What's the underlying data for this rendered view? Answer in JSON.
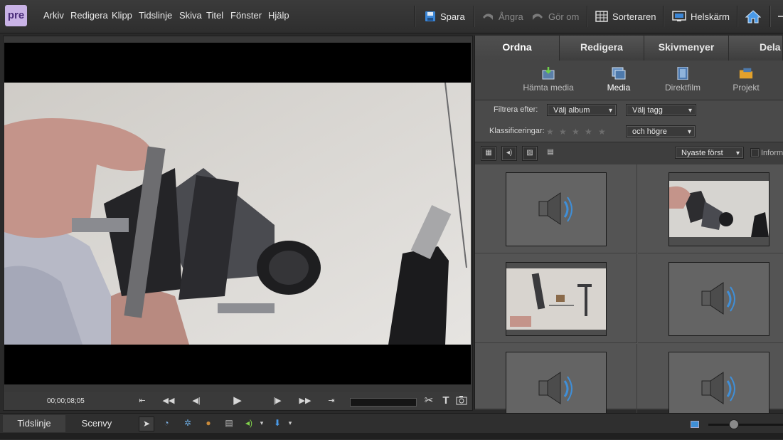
{
  "app": {
    "logo_text": "pre"
  },
  "menu": [
    "Arkiv",
    "Redigera",
    "Klipp",
    "Tidslinje",
    "Skiva",
    "Titel",
    "Fönster",
    "Hjälp"
  ],
  "toolbar": {
    "save": "Spara",
    "undo": "Ångra",
    "redo": "Gör om",
    "organizer": "Sorteraren",
    "fullscreen": "Helskärm"
  },
  "monitor": {
    "timecode": "00;00;08;05"
  },
  "panel": {
    "tabs": [
      "Ordna",
      "Redigera",
      "Skivmenyer",
      "Dela"
    ],
    "active_tab": "Ordna",
    "subnav": [
      "Hämta media",
      "Media",
      "Direktfilm",
      "Projekt"
    ],
    "active_subnav": "Media",
    "filter_label": "Filtrera efter:",
    "album_dropdown": "Välj album",
    "tag_dropdown": "Välj tagg",
    "rating_label": "Klassificeringar:",
    "rating_dropdown": "och högre",
    "sort_dropdown": "Nyaste först",
    "info_checkbox": "Inform"
  },
  "media_items": [
    {
      "type": "audio"
    },
    {
      "type": "video"
    },
    {
      "type": "video"
    },
    {
      "type": "audio"
    },
    {
      "type": "audio"
    },
    {
      "type": "audio"
    }
  ],
  "bottom": {
    "tabs": [
      "Tidslinje",
      "Scenvy"
    ],
    "active_tab": "Tidslinje"
  },
  "colors": {
    "logo_bg": "#c9b3e6",
    "accent_blue": "#2f7fd8"
  }
}
